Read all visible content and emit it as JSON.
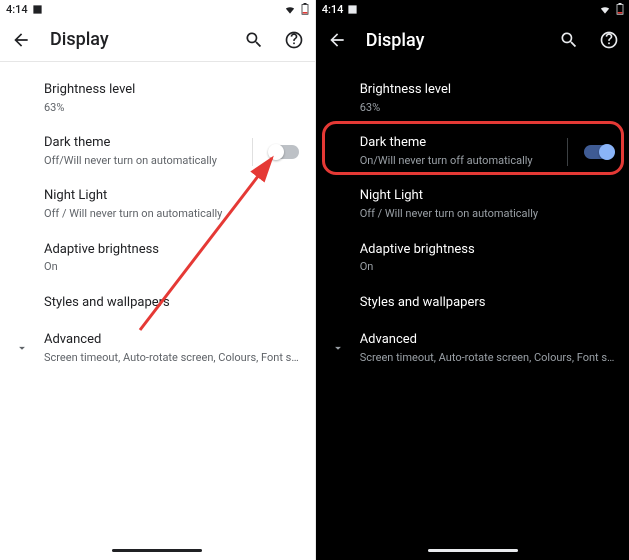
{
  "status": {
    "time": "4:14"
  },
  "header": {
    "title": "Display"
  },
  "left": {
    "brightness": {
      "title": "Brightness level",
      "sub": "63%"
    },
    "dark_theme": {
      "title": "Dark theme",
      "sub": "Off/Will never turn on automatically"
    },
    "night_light": {
      "title": "Night Light",
      "sub": "Off / Will never turn on automatically"
    },
    "adaptive": {
      "title": "Adaptive brightness",
      "sub": "On"
    },
    "styles": {
      "title": "Styles and wallpapers"
    },
    "advanced": {
      "title": "Advanced",
      "sub": "Screen timeout, Auto-rotate screen, Colours, Font s…"
    }
  },
  "right": {
    "brightness": {
      "title": "Brightness level",
      "sub": "63%"
    },
    "dark_theme": {
      "title": "Dark theme",
      "sub": "On/Will never turn off automatically"
    },
    "night_light": {
      "title": "Night Light",
      "sub": "Off / Will never turn on automatically"
    },
    "adaptive": {
      "title": "Adaptive brightness",
      "sub": "On"
    },
    "styles": {
      "title": "Styles and wallpapers"
    },
    "advanced": {
      "title": "Advanced",
      "sub": "Screen timeout, Auto-rotate screen, Colours, Font s…"
    }
  }
}
